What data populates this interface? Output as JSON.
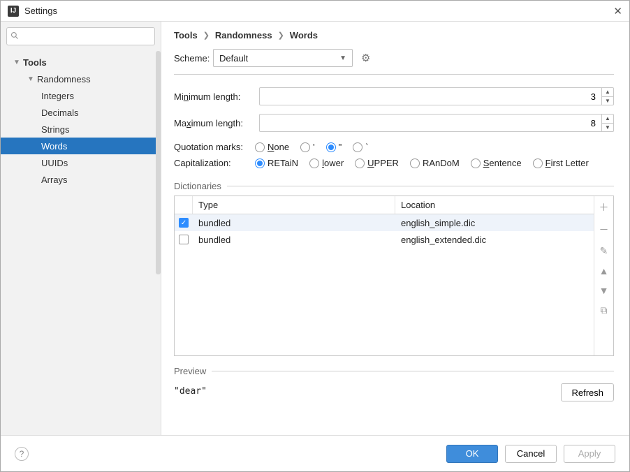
{
  "title": "Settings",
  "search_placeholder": "",
  "tree": {
    "root": "Tools",
    "group": "Randomness",
    "items": [
      "Integers",
      "Decimals",
      "Strings",
      "Words",
      "UUIDs",
      "Arrays"
    ],
    "selected": "Words"
  },
  "breadcrumb": [
    "Tools",
    "Randomness",
    "Words"
  ],
  "scheme": {
    "label": "Scheme:",
    "value": "Default"
  },
  "fields": {
    "min": {
      "label": "Minimum length:",
      "hotkey_index": 2,
      "value": "3"
    },
    "max": {
      "label": "Maximum length:",
      "hotkey_index": 2,
      "value": "8"
    }
  },
  "quotation": {
    "label": "Quotation marks:",
    "options": [
      {
        "label": "None",
        "hot": 0,
        "checked": false
      },
      {
        "label": "'",
        "checked": false
      },
      {
        "label": "\"",
        "checked": true
      },
      {
        "label": "`",
        "checked": false
      }
    ]
  },
  "capitalization": {
    "label": "Capitalization:",
    "options": [
      {
        "label": "RETaiN",
        "checked": true
      },
      {
        "label": "lower",
        "hot": 0,
        "checked": false
      },
      {
        "label": "UPPER",
        "hot": 0,
        "checked": false
      },
      {
        "label": "RAnDoM",
        "checked": false
      },
      {
        "label": "Sentence",
        "hot": 0,
        "checked": false
      },
      {
        "label": "First Letter",
        "hot": 0,
        "checked": false
      }
    ]
  },
  "dictionaries": {
    "label": "Dictionaries",
    "headers": {
      "type": "Type",
      "location": "Location"
    },
    "rows": [
      {
        "checked": true,
        "type": "bundled",
        "location": "english_simple.dic"
      },
      {
        "checked": false,
        "type": "bundled",
        "location": "english_extended.dic"
      }
    ]
  },
  "preview": {
    "label": "Preview",
    "value": "\"dear\"",
    "refresh": "Refresh"
  },
  "footer": {
    "ok": "OK",
    "cancel": "Cancel",
    "apply": "Apply"
  }
}
